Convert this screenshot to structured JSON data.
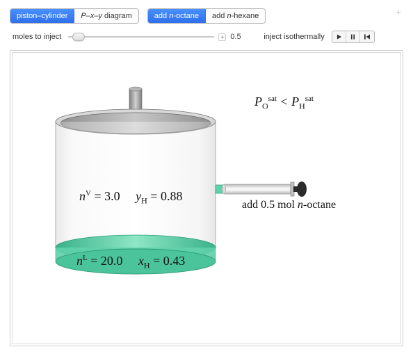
{
  "topbar": {
    "view_buttons": [
      {
        "label": "piston–cylinder",
        "active": true
      },
      {
        "label_html": "P–x–y diagram",
        "active": false
      }
    ],
    "add_buttons": [
      {
        "label_html": "add n-octane",
        "active": true
      },
      {
        "label_html": "add n-hexane",
        "active": false
      }
    ],
    "expand_icon": "+"
  },
  "slider": {
    "label": "moles to inject",
    "value": "0.5",
    "min": 0.0,
    "max": 2.0,
    "thumb_fraction": 0.03,
    "expand_icon": "+"
  },
  "inject": {
    "label": "inject isothermally",
    "controls": [
      "play",
      "pause",
      "reset"
    ]
  },
  "psat_relation": {
    "left_base": "P",
    "left_sup": "sat",
    "left_sub": "O",
    "relation": " < ",
    "right_base": "P",
    "right_sup": "sat",
    "right_sub": "H"
  },
  "syringe_caption": {
    "prefix": "add ",
    "amount": "0.5",
    "mid": " mol ",
    "species_prefix": "n",
    "species": "-octane"
  },
  "vapor": {
    "n_sym_base": "n",
    "n_sym_sup": "V",
    "n_eq": " = ",
    "n_val": "3.0",
    "y_sym_base": "y",
    "y_sym_sub": "H",
    "y_eq": " = ",
    "y_val": "0.88"
  },
  "liquid": {
    "n_sym_base": "n",
    "n_sym_sup": "L",
    "n_eq": " = ",
    "n_val": "20.0",
    "x_sym_base": "x",
    "x_sym_sub": "H",
    "x_eq": " = ",
    "x_val": "0.43"
  },
  "colors": {
    "liquid_fill": "#5fd1ab",
    "liquid_edge": "#3ab28a",
    "metal_light": "#ededed",
    "metal_dark": "#9c9c9c",
    "accent_blue": "#3a7df1"
  },
  "chart_data": {
    "type": "diagram",
    "title": "Piston-cylinder VLE with injection",
    "phases": {
      "vapor": {
        "moles": 3.0,
        "y_H": 0.88
      },
      "liquid": {
        "moles": 20.0,
        "x_H": 0.43
      }
    },
    "injection": {
      "species": "n-octane",
      "moles": 0.5,
      "mode": "isothermal"
    },
    "relation": "P_sat_O < P_sat_H"
  }
}
